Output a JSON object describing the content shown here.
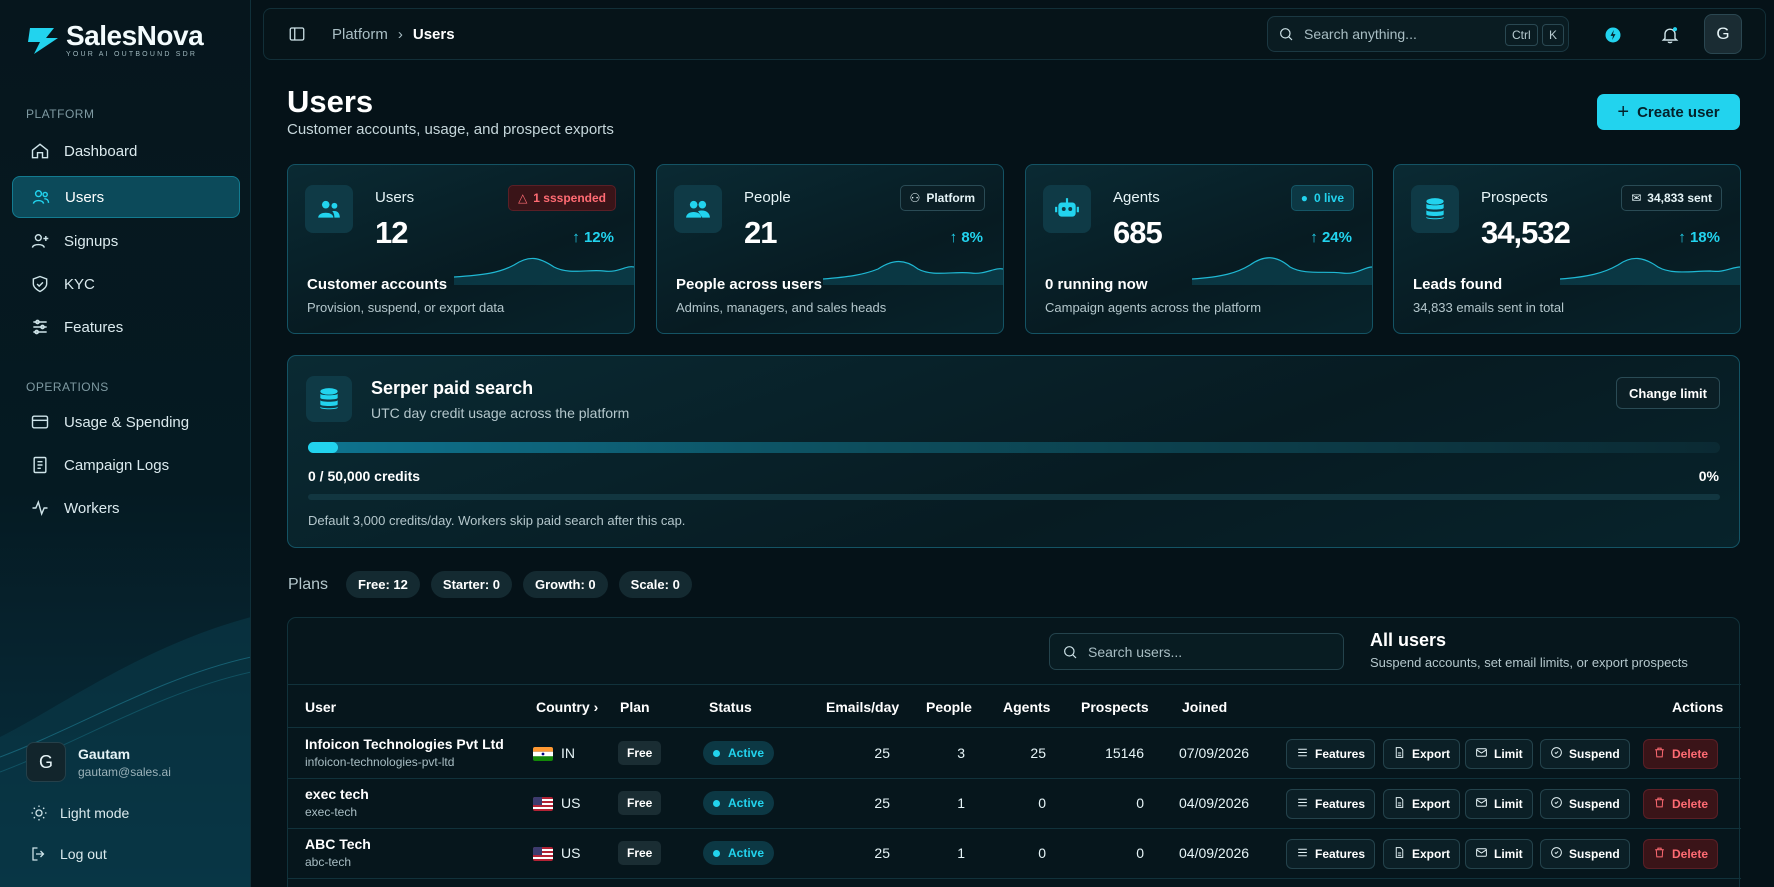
{
  "brand": {
    "name": "SalesNova",
    "tagline": "YOUR AI OUTBOUND SDR"
  },
  "sidebar": {
    "section_platform": "PLATFORM",
    "section_operations": "OPERATIONS",
    "items": [
      {
        "label": "Dashboard",
        "icon": "home-icon"
      },
      {
        "label": "Users",
        "icon": "users-icon",
        "active": true
      },
      {
        "label": "Signups",
        "icon": "user-plus-icon"
      },
      {
        "label": "KYC",
        "icon": "shield-check-icon"
      },
      {
        "label": "Features",
        "icon": "sliders-icon"
      }
    ],
    "ops_items": [
      {
        "label": "Usage & Spending",
        "icon": "wallet-icon"
      },
      {
        "label": "Campaign Logs",
        "icon": "logs-icon"
      },
      {
        "label": "Workers",
        "icon": "activity-icon"
      }
    ],
    "user": {
      "initial": "G",
      "name": "Gautam",
      "email": "gautam@sales.ai"
    },
    "light_mode": "Light mode",
    "logout": "Log out"
  },
  "topbar": {
    "breadcrumb_parent": "Platform",
    "breadcrumb_current": "Users",
    "search_placeholder": "Search anything...",
    "kbd_ctrl": "Ctrl",
    "kbd_k": "K",
    "avatar_initial": "G"
  },
  "page": {
    "title": "Users",
    "subtitle": "Customer accounts, usage, and prospect exports",
    "create_button": "Create user"
  },
  "cards": [
    {
      "label": "Users",
      "value": "12",
      "badge": "1 ssspended",
      "trend": "12%",
      "title": "Customer accounts",
      "desc": "Provision, suspend, or export data"
    },
    {
      "label": "People",
      "value": "21",
      "badge": "Platform",
      "trend": "8%",
      "title": "People across users",
      "desc": "Admins, managers, and sales heads"
    },
    {
      "label": "Agents",
      "value": "685",
      "badge": "0 live",
      "trend": "24%",
      "title": "0 running now",
      "desc": "Campaign agents across the platform"
    },
    {
      "label": "Prospects",
      "value": "34,532",
      "badge": "34,833 sent",
      "trend": "18%",
      "title": "Leads found",
      "desc": "34,833 emails sent in total"
    }
  ],
  "serper": {
    "title": "Serper paid search",
    "subtitle": "UTC day credit usage across the platform",
    "change_button": "Change limit",
    "credits": "0 / 50,000 credits",
    "percent": "0%",
    "usage_fraction": 0,
    "note": "Default 3,000 credits/day. Workers skip paid search after this cap."
  },
  "plans": {
    "label": "Plans",
    "chips": [
      "Free: 12",
      "Starter: 0",
      "Growth: 0",
      "Scale: 0"
    ]
  },
  "table": {
    "search_placeholder": "Search users...",
    "title": "All users",
    "subtitle": "Suspend accounts, set email limits, or export prospects",
    "headers": {
      "user": "User",
      "country": "Country",
      "plan": "Plan",
      "status": "Status",
      "emails": "Emails/day",
      "people": "People",
      "agents": "Agents",
      "prospects": "Prospects",
      "joined": "Joined",
      "actions": "Actions"
    },
    "actions": {
      "features": "Features",
      "export": "Export",
      "limit": "Limit",
      "suspend": "Suspend",
      "delete": "Delete"
    },
    "rows": [
      {
        "name": "Infoicon Technologies Pvt Ltd",
        "slug": "infoicon-technologies-pvt-ltd",
        "country": "IN",
        "plan": "Free",
        "status": "Active",
        "emails": "25",
        "people": "3",
        "agents": "25",
        "prospects": "15146",
        "joined": "07/09/2026"
      },
      {
        "name": "exec tech",
        "slug": "exec-tech",
        "country": "US",
        "plan": "Free",
        "status": "Active",
        "emails": "25",
        "people": "1",
        "agents": "0",
        "prospects": "0",
        "joined": "04/09/2026"
      },
      {
        "name": "ABC Tech",
        "slug": "abc-tech",
        "country": "US",
        "plan": "Free",
        "status": "Active",
        "emails": "25",
        "people": "1",
        "agents": "0",
        "prospects": "0",
        "joined": "04/09/2026"
      }
    ]
  },
  "colors": {
    "accent": "#22d3ee",
    "danger": "#ff6b73",
    "background": "#051218"
  }
}
